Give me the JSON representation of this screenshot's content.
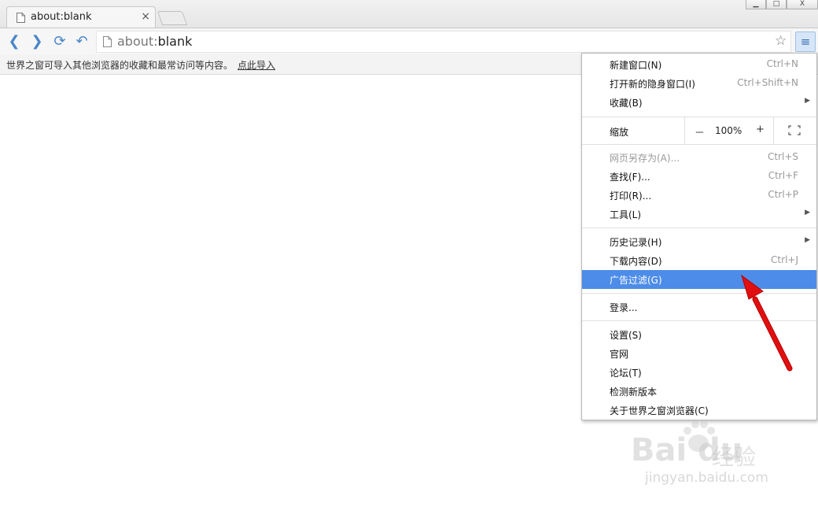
{
  "tab": {
    "title": "about:blank",
    "close": "×"
  },
  "window_controls": {
    "min": "▁",
    "max": "□",
    "close": "X"
  },
  "toolbar": {
    "icons": [
      "back-icon",
      "forward-icon",
      "reload-icon",
      "undo-icon",
      "star-icon",
      "menu-icon"
    ],
    "back": "❮",
    "forward": "❯",
    "reload": "⟳",
    "undo": "↶",
    "url_scheme": "about:",
    "url_rest": "blank",
    "star": "☆",
    "menu": "≡"
  },
  "importbar": {
    "message": "世界之窗可导入其他浏览器的收藏和最常访问等内容。",
    "link": "点此导入"
  },
  "menu": {
    "new_window": {
      "label": "新建窗口(N)",
      "shortcut": "Ctrl+N"
    },
    "incognito": {
      "label": "打开新的隐身窗口(I)",
      "shortcut": "Ctrl+Shift+N"
    },
    "favorites": {
      "label": "收藏(B)"
    },
    "zoom": {
      "label": "缩放",
      "minus": "－",
      "value": "100%",
      "plus": "+"
    },
    "save_as": {
      "label": "网页另存为(A)...",
      "shortcut": "Ctrl+S"
    },
    "find": {
      "label": "查找(F)...",
      "shortcut": "Ctrl+F"
    },
    "print": {
      "label": "打印(R)...",
      "shortcut": "Ctrl+P"
    },
    "tools": {
      "label": "工具(L)"
    },
    "history": {
      "label": "历史记录(H)"
    },
    "downloads": {
      "label": "下载内容(D)",
      "shortcut": "Ctrl+J"
    },
    "adblock": {
      "label": "广告过滤(G)"
    },
    "login": {
      "label": "登录..."
    },
    "settings": {
      "label": "设置(S)"
    },
    "official_site": {
      "label": "官网"
    },
    "forum": {
      "label": "论坛(T)"
    },
    "check_update": {
      "label": "检测新版本"
    },
    "about": {
      "label": "关于世界之窗浏览器(C)"
    },
    "submenu_arrow": "▶"
  },
  "watermark": {
    "brand": "Bai du",
    "cn": "经验",
    "url": "jingyan.baidu.com"
  },
  "colors": {
    "highlight": "#4d8ce8",
    "accent": "#4a86c8",
    "arrow": "#e01010"
  }
}
